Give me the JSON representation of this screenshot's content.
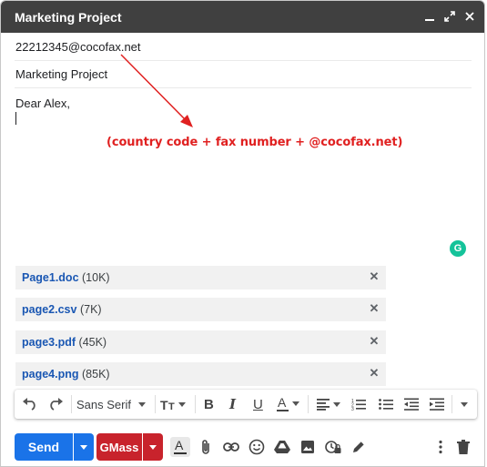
{
  "window": {
    "title": "Marketing Project"
  },
  "compose": {
    "to": "22212345@cocofax.net",
    "subject": "Marketing Project",
    "body_greeting": "Dear Alex,"
  },
  "annotation": {
    "text": "(country code + fax number + @cocofax.net)",
    "color": "#e02020"
  },
  "attachments": [
    {
      "name": "Page1.doc",
      "size": "(10K)"
    },
    {
      "name": "page2.csv",
      "size": "(7K)"
    },
    {
      "name": "page3.pdf",
      "size": "(45K)"
    },
    {
      "name": "page4.png",
      "size": "(85K)"
    }
  ],
  "formatting_toolbar": {
    "font_family": "Sans Serif",
    "icons": [
      "undo-icon",
      "redo-icon",
      "font-size-icon",
      "bold-icon",
      "italic-icon",
      "underline-icon",
      "text-color-icon",
      "align-icon",
      "numbered-list-icon",
      "bulleted-list-icon",
      "indent-less-icon",
      "indent-more-icon",
      "more-formatting-icon"
    ]
  },
  "bottom_toolbar": {
    "send_label": "Send",
    "gmass_label": "GMass",
    "icons": [
      "formatting-options-icon",
      "attach-file-icon",
      "insert-link-icon",
      "emoji-icon",
      "google-drive-icon",
      "insert-photo-icon",
      "confidential-mode-icon",
      "signature-icon",
      "more-options-icon",
      "discard-draft-icon"
    ]
  },
  "colors": {
    "titlebar": "#404040",
    "send_button": "#1a73e8",
    "gmass_button": "#c8232c",
    "attachment_link": "#1a57b3",
    "grammarly": "#15c39a"
  }
}
